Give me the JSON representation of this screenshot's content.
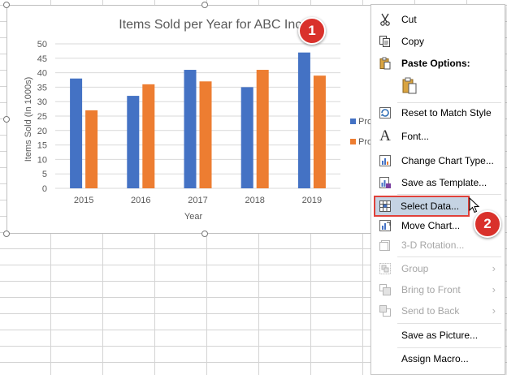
{
  "chart_data": {
    "type": "bar",
    "title": "Items Sold per Year for ABC Inc.",
    "xlabel": "Year",
    "ylabel": "Items Sold (In 1000s)",
    "categories": [
      "2015",
      "2016",
      "2017",
      "2018",
      "2019"
    ],
    "ylim": [
      0,
      50
    ],
    "yticks": [
      "0",
      "5",
      "10",
      "15",
      "20",
      "25",
      "30",
      "35",
      "40",
      "45",
      "50"
    ],
    "grid": true,
    "legend_position": "right",
    "legend_labels": [
      "Pro",
      "Pro"
    ],
    "series": [
      {
        "color": "#4472c4",
        "values": [
          38,
          32,
          41,
          35,
          47
        ]
      },
      {
        "color": "#ed7d31",
        "values": [
          27,
          36,
          37,
          41,
          39
        ]
      }
    ]
  },
  "callouts": {
    "badge1": "1",
    "badge2": "2"
  },
  "menu": {
    "cut": "Cut",
    "copy": "Copy",
    "paste_options": "Paste Options:",
    "reset": "Reset to Match Style",
    "font": "Font...",
    "change_type": "Change Chart Type...",
    "save_template": "Save as Template...",
    "select_data": "Select Data...",
    "move_chart": "Move Chart...",
    "rotation": "3-D Rotation...",
    "group": "Group",
    "bring_front": "Bring to Front",
    "send_back": "Send to Back",
    "save_picture": "Save as Picture...",
    "assign_macro": "Assign Macro..."
  },
  "colors": {
    "accent_red": "#d9312b",
    "selection_blue": "#c5d3e3"
  }
}
